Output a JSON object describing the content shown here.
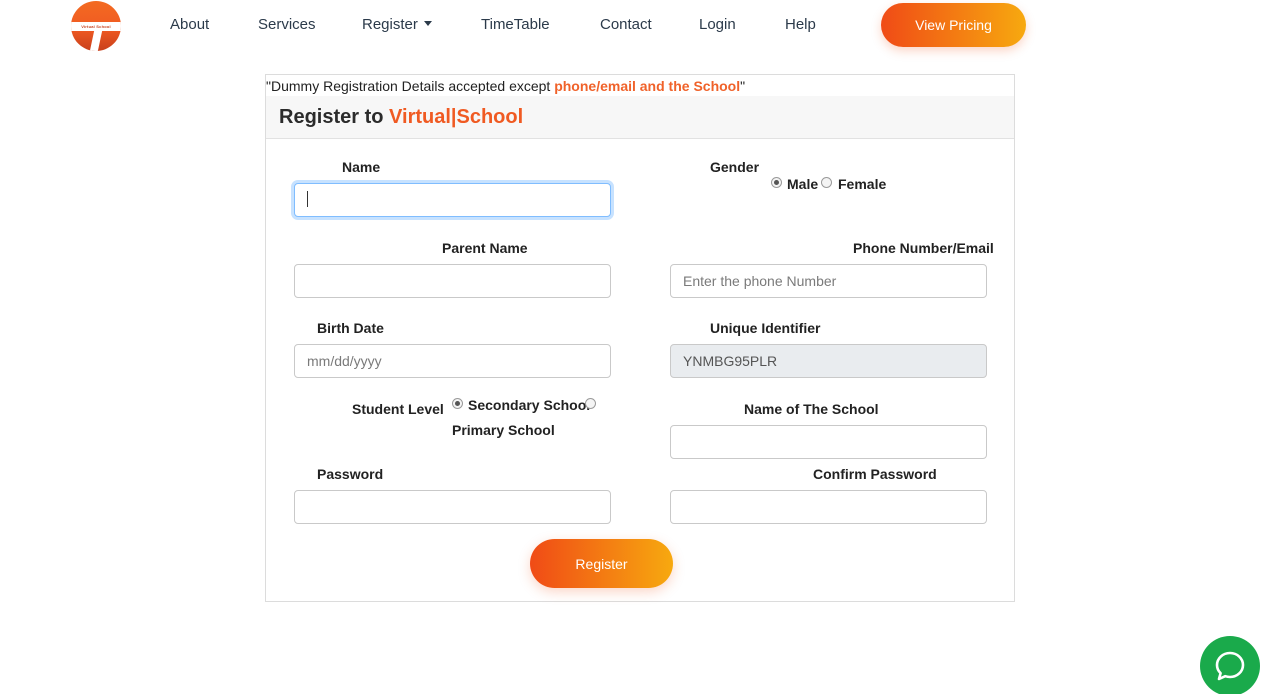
{
  "nav": {
    "items": [
      {
        "label": "About"
      },
      {
        "label": "Services"
      },
      {
        "label": "Register"
      },
      {
        "label": "TimeTable"
      },
      {
        "label": "Contact"
      },
      {
        "label": "Login"
      },
      {
        "label": "Help"
      }
    ],
    "pricing_button": "View Pricing"
  },
  "notice": {
    "prefix": "\"Dummy Registration Details accepted except ",
    "highlight": "phone/email and the School",
    "suffix": "\""
  },
  "form": {
    "title_prefix": "Register to ",
    "title_brand": "Virtual|School",
    "name_label": "Name",
    "gender_label": "Gender",
    "gender_options": {
      "male": "Male",
      "female": "Female"
    },
    "gender_selected": "Male",
    "parent_name_label": "Parent Name",
    "phone_label": "Phone Number/Email",
    "phone_placeholder": "Enter the phone Number",
    "birth_date_label": "Birth Date",
    "birth_date_placeholder": "mm/dd/yyyy",
    "unique_id_label": "Unique Identifier",
    "unique_id_value": "YNMBG95PLR",
    "student_level_label": "Student Level",
    "level_options": {
      "secondary": "Secondary School",
      "primary": "Primary School"
    },
    "level_selected": "Secondary School",
    "school_name_label": "Name of The School",
    "password_label": "Password",
    "confirm_password_label": "Confirm Password",
    "submit_label": "Register"
  },
  "colors": {
    "accent": "#f05a22",
    "gradient_start": "#f04b16",
    "gradient_end": "#f7a90f",
    "chat": "#1aaa4b"
  },
  "icons": {
    "logo": "virtual-school-logo",
    "chat": "chat-bubble-icon",
    "dropdown": "caret-down-icon"
  }
}
